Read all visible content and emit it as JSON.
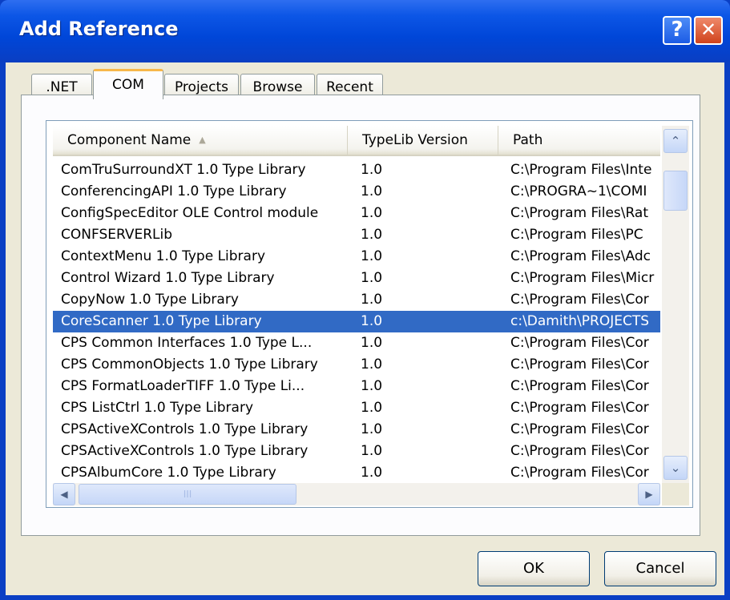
{
  "window": {
    "title": "Add Reference",
    "help_label": "?",
    "close_label": "✕"
  },
  "tabs": [
    {
      "label": ".NET",
      "active": false
    },
    {
      "label": "COM",
      "active": true
    },
    {
      "label": "Projects",
      "active": false
    },
    {
      "label": "Browse",
      "active": false
    },
    {
      "label": "Recent",
      "active": false
    }
  ],
  "list": {
    "columns": [
      "Component Name",
      "TypeLib Version",
      "Path"
    ],
    "sort_indicator": "▲",
    "selected_index": 7,
    "rows": [
      {
        "name": "ComTruSurroundXT 1.0 Type Library",
        "version": "1.0",
        "path": "C:\\Program Files\\Inte"
      },
      {
        "name": "ConferencingAPI 1.0 Type Library",
        "version": "1.0",
        "path": "C:\\PROGRA~1\\COMI"
      },
      {
        "name": "ConfigSpecEditor OLE Control module",
        "version": "1.0",
        "path": "C:\\Program Files\\Rat"
      },
      {
        "name": "CONFSERVERLib",
        "version": "1.0",
        "path": "C:\\Program Files\\PC"
      },
      {
        "name": "ContextMenu 1.0 Type Library",
        "version": "1.0",
        "path": "C:\\Program Files\\Adc"
      },
      {
        "name": "Control Wizard 1.0 Type Library",
        "version": "1.0",
        "path": "C:\\Program Files\\Micr"
      },
      {
        "name": "CopyNow 1.0 Type Library",
        "version": "1.0",
        "path": "C:\\Program Files\\Cor"
      },
      {
        "name": "CoreScanner 1.0 Type Library",
        "version": "1.0",
        "path": "c:\\Damith\\PROJECTS"
      },
      {
        "name": "CPS Common Interfaces 1.0 Type L...",
        "version": "1.0",
        "path": "C:\\Program Files\\Cor"
      },
      {
        "name": "CPS CommonObjects 1.0 Type Library",
        "version": "1.0",
        "path": "C:\\Program Files\\Cor"
      },
      {
        "name": "CPS FormatLoaderTIFF 1.0 Type Li...",
        "version": "1.0",
        "path": "C:\\Program Files\\Cor"
      },
      {
        "name": "CPS ListCtrl 1.0 Type Library",
        "version": "1.0",
        "path": "C:\\Program Files\\Cor"
      },
      {
        "name": "CPSActiveXControls 1.0 Type Library",
        "version": "1.0",
        "path": "C:\\Program Files\\Cor"
      },
      {
        "name": "CPSActiveXControls 1.0 Type Library",
        "version": "1.0",
        "path": "C:\\Program Files\\Cor"
      },
      {
        "name": "CPSAlbumCore 1.0 Type Library",
        "version": "1.0",
        "path": "C:\\Program Files\\Cor"
      }
    ]
  },
  "scrollbars": {
    "up_icon": "⌃",
    "down_icon": "⌄",
    "left_icon": "◀",
    "right_icon": "▶",
    "grip": "III"
  },
  "buttons": {
    "ok": "OK",
    "cancel": "Cancel"
  }
}
